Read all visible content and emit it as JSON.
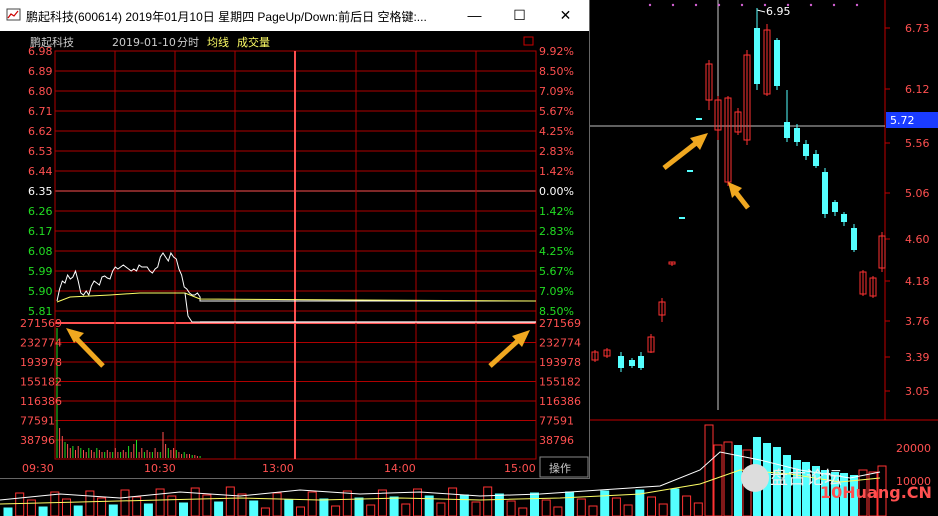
{
  "window": {
    "title": "鹏起科技(600614) 2019年01月10日 星期四 PageUp/Down:前后日 空格键:...",
    "min_glyph": "—",
    "max_glyph": "☐",
    "close_glyph": "✕"
  },
  "header": {
    "name": "鹏起科技",
    "date": "2019-01-10",
    "mode": "分时",
    "avg_label": "均线",
    "vol_label": "成交量"
  },
  "intraday": {
    "price_ticks": [
      "6.98",
      "6.89",
      "6.80",
      "6.71",
      "6.62",
      "6.53",
      "6.44",
      "6.35",
      "6.26",
      "6.17",
      "6.08",
      "5.99",
      "5.90",
      "5.81"
    ],
    "pct_ticks": [
      "9.92%",
      "8.50%",
      "7.09%",
      "5.67%",
      "4.25%",
      "2.83%",
      "1.42%",
      "0.00%",
      "1.42%",
      "2.83%",
      "4.25%",
      "5.67%",
      "7.09%",
      "8.50%"
    ],
    "vol_ticks": [
      "271569",
      "232774",
      "193978",
      "155182",
      "116386",
      "77591",
      "38796"
    ],
    "time_ticks": [
      "09:30",
      "10:30",
      "13:00",
      "14:00",
      "15:00"
    ],
    "ops_label": "操作",
    "colors": {
      "up": "#ff3232",
      "down": "#00e600",
      "price_line": "#ffffff",
      "avg_line": "#ffff66",
      "grid": "#b00000"
    }
  },
  "kline": {
    "price_ticks": [
      "6.73",
      "6.12",
      "5.56",
      "5.06",
      "4.60",
      "4.18",
      "3.76",
      "3.39",
      "3.05"
    ],
    "current_price": "5.72",
    "high_label": "6.95",
    "vol_tick": "20000",
    "vol_tick2": "10000",
    "colors": {
      "up": "#ff3232",
      "down": "#54ffff",
      "axis": "#c00000",
      "crosshair": "#ffffff",
      "badge_bg": "#1a3cff"
    }
  },
  "watermark": {
    "brand": "盘古论坛",
    "site": "10Huang.CN"
  }
}
